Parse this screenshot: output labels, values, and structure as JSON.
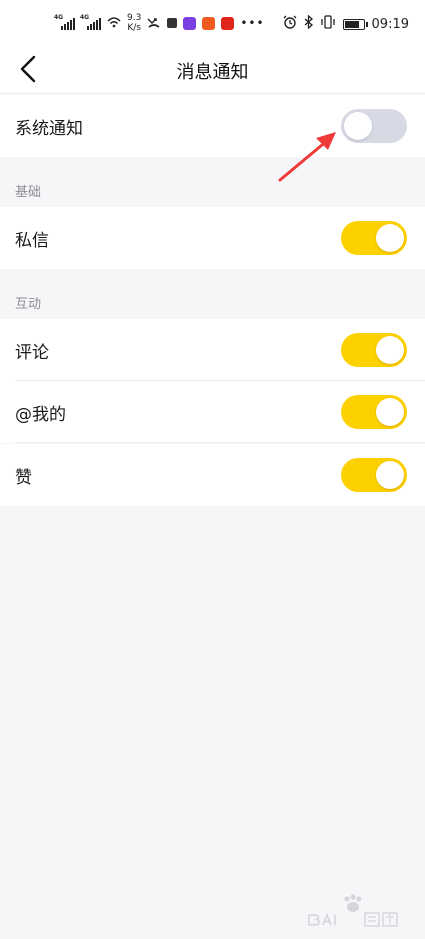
{
  "status_bar": {
    "net1": "4G",
    "net2": "4G",
    "speed_value": "9.3",
    "speed_unit": "K/s",
    "time": "09:19"
  },
  "header": {
    "title": "消息通知"
  },
  "system_notify": {
    "label": "系统通知",
    "enabled": false
  },
  "sections": {
    "basic": "基础",
    "interaction": "互动"
  },
  "items": {
    "private_message": {
      "label": "私信",
      "enabled": true
    },
    "comment": {
      "label": "评论",
      "enabled": true
    },
    "mention": {
      "label": "@我的",
      "enabled": true
    },
    "like": {
      "label": "赞",
      "enabled": true
    }
  },
  "colors": {
    "toggle_on": "#fdd000",
    "toggle_off": "#d7d9e4",
    "arrow": "#f03a3a",
    "page_bg": "#f6f6f9"
  },
  "icons": {
    "back": "chevron-left-icon",
    "alarm": "alarm-icon",
    "bluetooth": "bluetooth-icon",
    "vibrate": "vibrate-icon",
    "battery": "battery-icon",
    "wifi": "wifi-icon"
  }
}
